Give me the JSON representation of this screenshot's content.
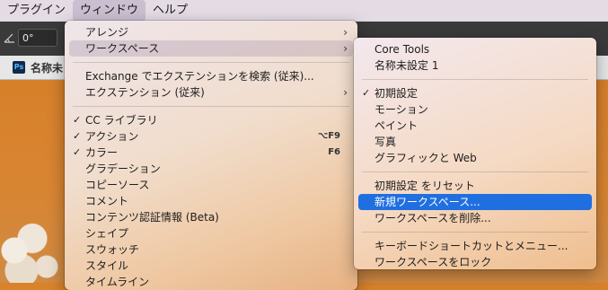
{
  "menubar": {
    "items": [
      "プラグイン",
      "ウィンドウ",
      "ヘルプ"
    ]
  },
  "toolbar": {
    "angle_value": "0°",
    "angle_icon": "angle-icon"
  },
  "document_tab": {
    "icon_text": "Ps",
    "label": "名称未"
  },
  "window_menu": {
    "arrange": "アレンジ",
    "workspace": "ワークスペース",
    "exchange_search": "Exchange でエクステンションを検索 (従来)...",
    "extensions": "エクステンション (従来)",
    "cc_libraries": "CC ライブラリ",
    "actions": "アクション",
    "actions_shortcut": "⌥F9",
    "color": "カラー",
    "color_shortcut": "F6",
    "gradients": "グラデーション",
    "clone_source": "コピーソース",
    "comments": "コメント",
    "content_credentials": "コンテンツ認証情報 (Beta)",
    "shapes": "シェイプ",
    "swatches": "スウォッチ",
    "styles": "スタイル",
    "timeline": "タイムライン"
  },
  "workspace_menu": {
    "core_tools": "Core Tools",
    "untitled_1": "名称未設定 1",
    "essentials": "初期設定",
    "motion": "モーション",
    "painting": "ペイント",
    "photography": "写真",
    "graphic_web": "グラフィックと Web",
    "reset_essentials": "初期設定 をリセット",
    "new_workspace": "新規ワークスペース...",
    "delete_workspace": "ワークスペースを削除...",
    "keyboard_shortcuts": "キーボードショートカットとメニュー...",
    "lock_workspace": "ワークスペースをロック"
  },
  "glyphs": {
    "check": "✓",
    "submenu_arrow": "›"
  },
  "colors": {
    "selection": "#1f6fe0",
    "canvas": "#d9822b"
  }
}
